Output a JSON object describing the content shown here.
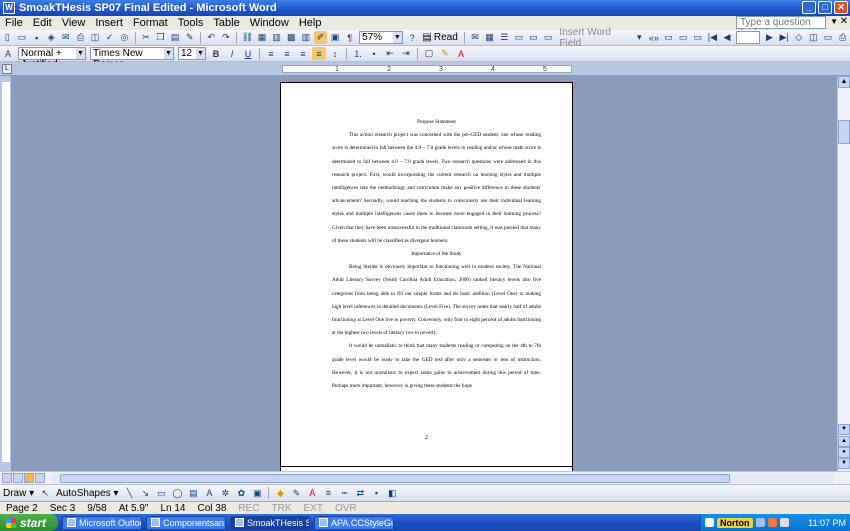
{
  "window": {
    "title": "SmoakTHesis SP07 Final Edited - Microsoft Word",
    "minimize": "_",
    "maximize": "□",
    "close": "✕"
  },
  "menu": {
    "items": [
      "File",
      "Edit",
      "View",
      "Insert",
      "Format",
      "Tools",
      "Table",
      "Window",
      "Help"
    ],
    "help_placeholder": "Type a question for help"
  },
  "toolbar": {
    "zoom": "57%",
    "read_label": "Read",
    "insert_word_field": "Insert Word Field"
  },
  "formatting": {
    "style": "Normal + Justified,",
    "font": "Times New Roman",
    "size": "12",
    "bold": "B",
    "italic": "I",
    "underline": "U"
  },
  "ruler": {
    "ticks": [
      "1",
      "2",
      "3",
      "4",
      "5"
    ]
  },
  "document": {
    "heading1": "Purpose Statement",
    "para1": "This action research project was concerned with the pre-GED student, one whose reading score is determined to fall between the 4.0 – 7.0 grade levels in reading and/or whose math score is determined to fall between 4.0 – 7.0 grade levels.  Two research questions were addressed in this research project.  First, would incorporating the current research on learning styles and multiple intelligences into the methodology and curriculum make any positive difference in these students' advancement?  Secondly, would teaching the students to consciously use their individual learning styles and multiple intelligences cause them to become more engaged in their learning process? Given that they have been unsuccessful in the traditional classroom setting, it was posited that many of these students will be classified as divergent learners.",
    "heading2": "Importance of the Study",
    "para2": "Being literate is obviously important to functioning well in modern society.  The National Adult Literacy Survey (South Carolina Adult Education, 2006) ranked literacy levels into five categories from being able to fill out simple forms and do basic addition (Level One) to making high level inferences in detailed documents (Level Five).  The survey notes that nearly half of adults functioning at Level One live in poverty. Conversely, only four to eight percent of adults functioning at the highest two levels of literacy live in poverty.",
    "para3": "It would be unrealistic to think that many students reading or computing on the 4th to 7th grade level would be ready to take the GED test after only a semester or less of instruction.  However, it is not unrealistic to expect some gains in achievement during this period of time.  Perhaps more important, however, is giving these students the hope",
    "page_number": "2"
  },
  "drawbar": {
    "draw_label": "Draw ▾",
    "autoshapes_label": "AutoShapes ▾"
  },
  "status": {
    "page": "Page 2",
    "sec": "Sec 3",
    "pages": "9/58",
    "at": "At 5.9\"",
    "ln": "Ln 14",
    "col": "Col 38",
    "rec": "REC",
    "trk": "TRK",
    "ext": "EXT",
    "ovr": "OVR"
  },
  "taskbar": {
    "start": "start",
    "buttons": [
      "Microsoft Outloo...",
      "Componentsan...",
      "SmoakTHesis SP...",
      "APA.CCStyleGui..."
    ],
    "norton": "Norton",
    "clock": "11:07 PM"
  },
  "colors": {
    "titlebar": "#1f55c9",
    "workspace": "#8a9bbb",
    "taskbar": "#1d4fc2"
  }
}
